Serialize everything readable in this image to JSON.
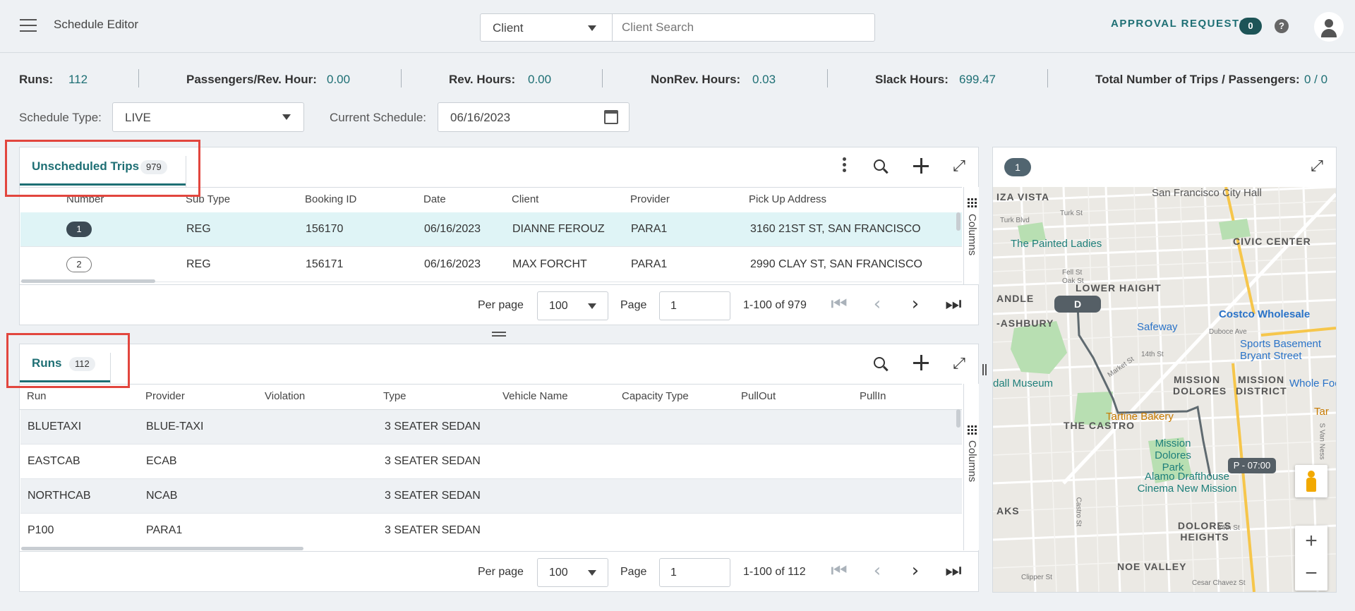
{
  "header": {
    "app_title": "Schedule Editor",
    "client_select": "Client",
    "client_search_placeholder": "Client Search",
    "approval_label": "APPROVAL REQUESTS",
    "approval_count": "0",
    "help": "?"
  },
  "stats": {
    "runs_label": "Runs:",
    "runs_value": "112",
    "pph_label": "Passengers/Rev. Hour:",
    "pph_value": "0.00",
    "rev_label": "Rev. Hours:",
    "rev_value": "0.00",
    "nonrev_label": "NonRev. Hours:",
    "nonrev_value": "0.03",
    "slack_label": "Slack Hours:",
    "slack_value": "699.47",
    "trips_label": "Total Number of Trips / Passengers:",
    "trips_value": "0 / 0"
  },
  "filters": {
    "schedule_type_label": "Schedule Type:",
    "schedule_type_value": "LIVE",
    "current_schedule_label": "Current Schedule:",
    "current_schedule_value": "06/16/2023"
  },
  "trips": {
    "tab_label": "Unscheduled Trips",
    "tab_count": "979",
    "columns": [
      "Number",
      "Sub Type",
      "Booking ID",
      "Date",
      "Client",
      "Provider",
      "Pick Up Address"
    ],
    "rows": [
      {
        "number": "1",
        "subtype": "REG",
        "booking": "156170",
        "date": "06/16/2023",
        "client": "DIANNE FEROUZ",
        "provider": "PARA1",
        "address": "3160 21ST ST, SAN FRANCISCO"
      },
      {
        "number": "2",
        "subtype": "REG",
        "booking": "156171",
        "date": "06/16/2023",
        "client": "MAX FORCHT",
        "provider": "PARA1",
        "address": "2990 CLAY ST, SAN FRANCISCO"
      }
    ],
    "columns_label": "Columns",
    "per_page_label": "Per page",
    "per_page_value": "100",
    "page_label": "Page",
    "page_value": "1",
    "range": "1-100 of 979"
  },
  "runs": {
    "tab_label": "Runs",
    "tab_count": "112",
    "columns": [
      "Run",
      "Provider",
      "Violation",
      "Type",
      "Vehicle Name",
      "Capacity Type",
      "PullOut",
      "PullIn"
    ],
    "rows": [
      {
        "run": "BLUETAXI",
        "provider": "BLUE-TAXI",
        "type": "3 SEATER SEDAN"
      },
      {
        "run": "EASTCAB",
        "provider": "ECAB",
        "type": "3 SEATER SEDAN"
      },
      {
        "run": "NORTHCAB",
        "provider": "NCAB",
        "type": "3 SEATER SEDAN"
      },
      {
        "run": "P100",
        "provider": "PARA1",
        "type": "3 SEATER SEDAN"
      }
    ],
    "columns_label": "Columns",
    "per_page_label": "Per page",
    "per_page_value": "100",
    "page_label": "Page",
    "page_value": "1",
    "range": "1-100 of 112"
  },
  "map": {
    "badge": "1",
    "neighborhoods": [
      "CIVIC CENTER",
      "LOWER HAIGHT",
      "MISSION DOLORES",
      "MISSION DISTRICT",
      "THE CASTRO",
      "DOLORES HEIGHTS",
      "NOE VALLEY",
      "IZA VISTA",
      "ANDLE",
      "-ASHBURY",
      "AKS"
    ],
    "pois": [
      "San Francisco City Hall",
      "The Painted Ladies",
      "Safeway",
      "Costco Wholesale",
      "Sports Basement Bryant Street",
      "dall Museum",
      "Tartine Bakery",
      "Mission Dolores Park",
      "Alamo Drafthouse Cinema New Mission",
      "Whole Foo",
      "Tar"
    ],
    "streets": [
      "Turk St",
      "Turk Blvd",
      "Fell St",
      "Oak St",
      "14th St",
      "Duboce Ave",
      "Market St",
      "Castro St",
      "24th St",
      "Clipper St",
      "Cesar Chavez St",
      "S Van Ness"
    ],
    "marker_d": "D",
    "marker_p": "P - 07:00",
    "colors": {
      "route": "#5f6a70",
      "park": "#b8dfb2",
      "arterial": "#f6c64b"
    }
  }
}
